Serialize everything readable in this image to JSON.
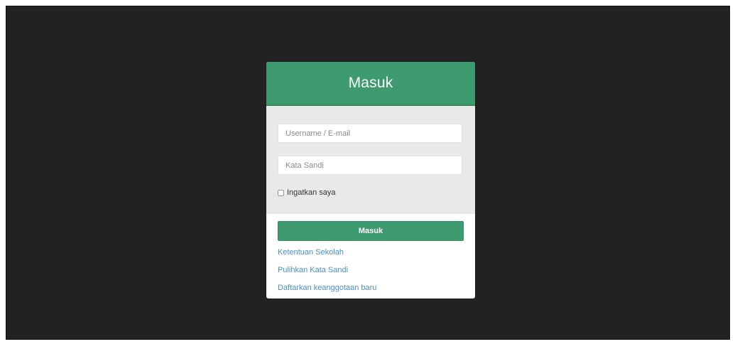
{
  "login": {
    "title": "Masuk",
    "username_placeholder": "Username / E-mail",
    "password_placeholder": "Kata Sandi",
    "remember_label": "Ingatkan saya",
    "remember_checked": false,
    "submit_label": "Masuk",
    "links": [
      "Ketentuan Sekolah",
      "Pulihkan Kata Sandi",
      "Daftarkan keanggotaan baru"
    ]
  },
  "colors": {
    "background": "#222222",
    "accent": "#3e9b6f",
    "form_panel": "#e9e9ea",
    "link": "#4a8fc6"
  }
}
